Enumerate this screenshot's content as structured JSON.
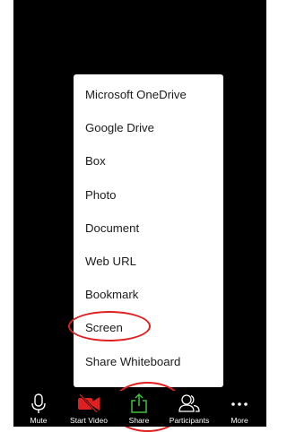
{
  "share_menu": {
    "items": [
      {
        "label": "Microsoft OneDrive"
      },
      {
        "label": "Google Drive"
      },
      {
        "label": "Box"
      },
      {
        "label": "Photo"
      },
      {
        "label": "Document"
      },
      {
        "label": "Web URL"
      },
      {
        "label": "Bookmark"
      },
      {
        "label": "Screen"
      },
      {
        "label": "Share Whiteboard"
      }
    ]
  },
  "toolbar": {
    "items": [
      {
        "label": "Mute",
        "icon": "microphone-icon"
      },
      {
        "label": "Start Video",
        "icon": "video-camera-off-icon"
      },
      {
        "label": "Share",
        "icon": "share-upload-icon"
      },
      {
        "label": "Participants",
        "icon": "participants-icon"
      },
      {
        "label": "More",
        "icon": "more-dots-icon"
      }
    ]
  },
  "colors": {
    "background": "#000000",
    "menu_background": "#ffffff",
    "menu_text": "#1b1b1b",
    "annotation_red": "#e02020",
    "video_off_red": "#e02020",
    "share_green": "#3cc43c",
    "toolbar_text": "#ffffff"
  }
}
